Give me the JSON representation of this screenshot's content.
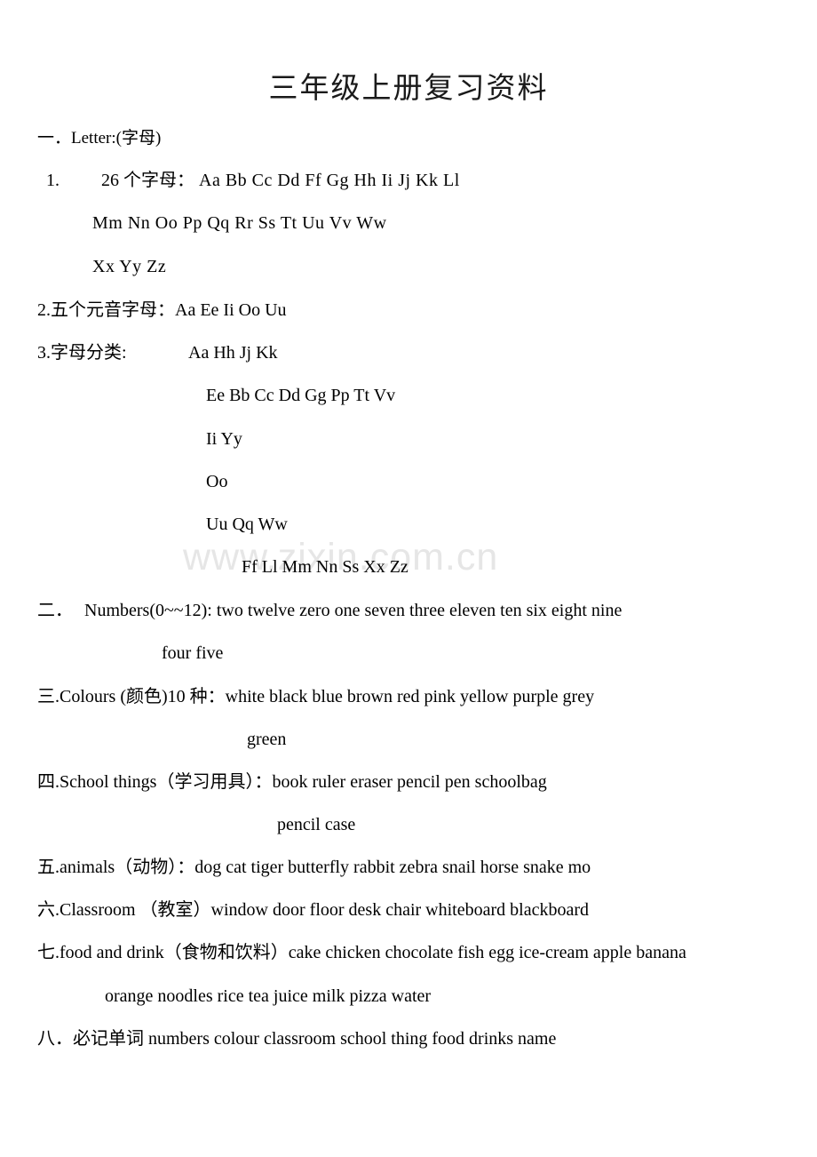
{
  "document": {
    "title": "三年级上册复习资料",
    "watermark": "www.zixin.com.cn"
  },
  "sections": {
    "letter": {
      "heading": "一．Letter:(字母)",
      "item1_label": "1.",
      "item1_text": "26 个字母：",
      "alphabet_row1": "Aa    Bb    Cc    Dd       Ff      Gg        Hh     Ii     Jj     Kk    Ll",
      "alphabet_row2": "Mm   Nn   Oo   Pp   Qq       Rr   Ss      Tt     Uu      Vv       Ww",
      "alphabet_row3": "Xx    Yy   Zz",
      "item2_text": "2.五个元音字母：Aa    Ee      Ii       Oo     Uu",
      "item3_text": "3.字母分类:",
      "group1": "Aa    Hh      Jj     Kk",
      "group2": "Ee    Bb    Cc   Dd   Gg   Pp   Tt    Vv",
      "group3": "Ii    Yy",
      "group4": "Oo",
      "group5": "Uu   Qq    Ww",
      "group6": "Ff    Ll   Mm    Nn    Ss    Xx    Zz"
    },
    "numbers": {
      "heading": "二．",
      "line1": "Numbers(0~~12): two twelve   zero   one   seven   three eleven    ten   six eight    nine",
      "line2": "four   five"
    },
    "colours": {
      "line1": "三.Colours (颜色)10 种：white   black    blue   brown    red   pink    yellow   purple    grey",
      "line2": "green"
    },
    "school_things": {
      "line1": "四.School things（学习用具）：book   ruler     eraser     pencil     pen   schoolbag",
      "line2": "pencil case"
    },
    "animals": {
      "line1": "五.animals（动物）：dog cat   tiger          butterfly rabbit         zebra   snail   horse   snake   mo"
    },
    "classroom": {
      "line1": "六.Classroom  （教室）window   door   floor desk    chair     whiteboard   blackboard"
    },
    "food_and_drink": {
      "line1": "七.food and drink（食物和饮料）cake chicken chocolate   fish egg     ice-cream   apple   banana",
      "line2": "orange   noodles rice   tea     juice   milk   pizza water"
    },
    "must_know_words": {
      "line1": "八．必记单词 numbers   colour     classroom   school thing   food   drinks   name"
    }
  }
}
